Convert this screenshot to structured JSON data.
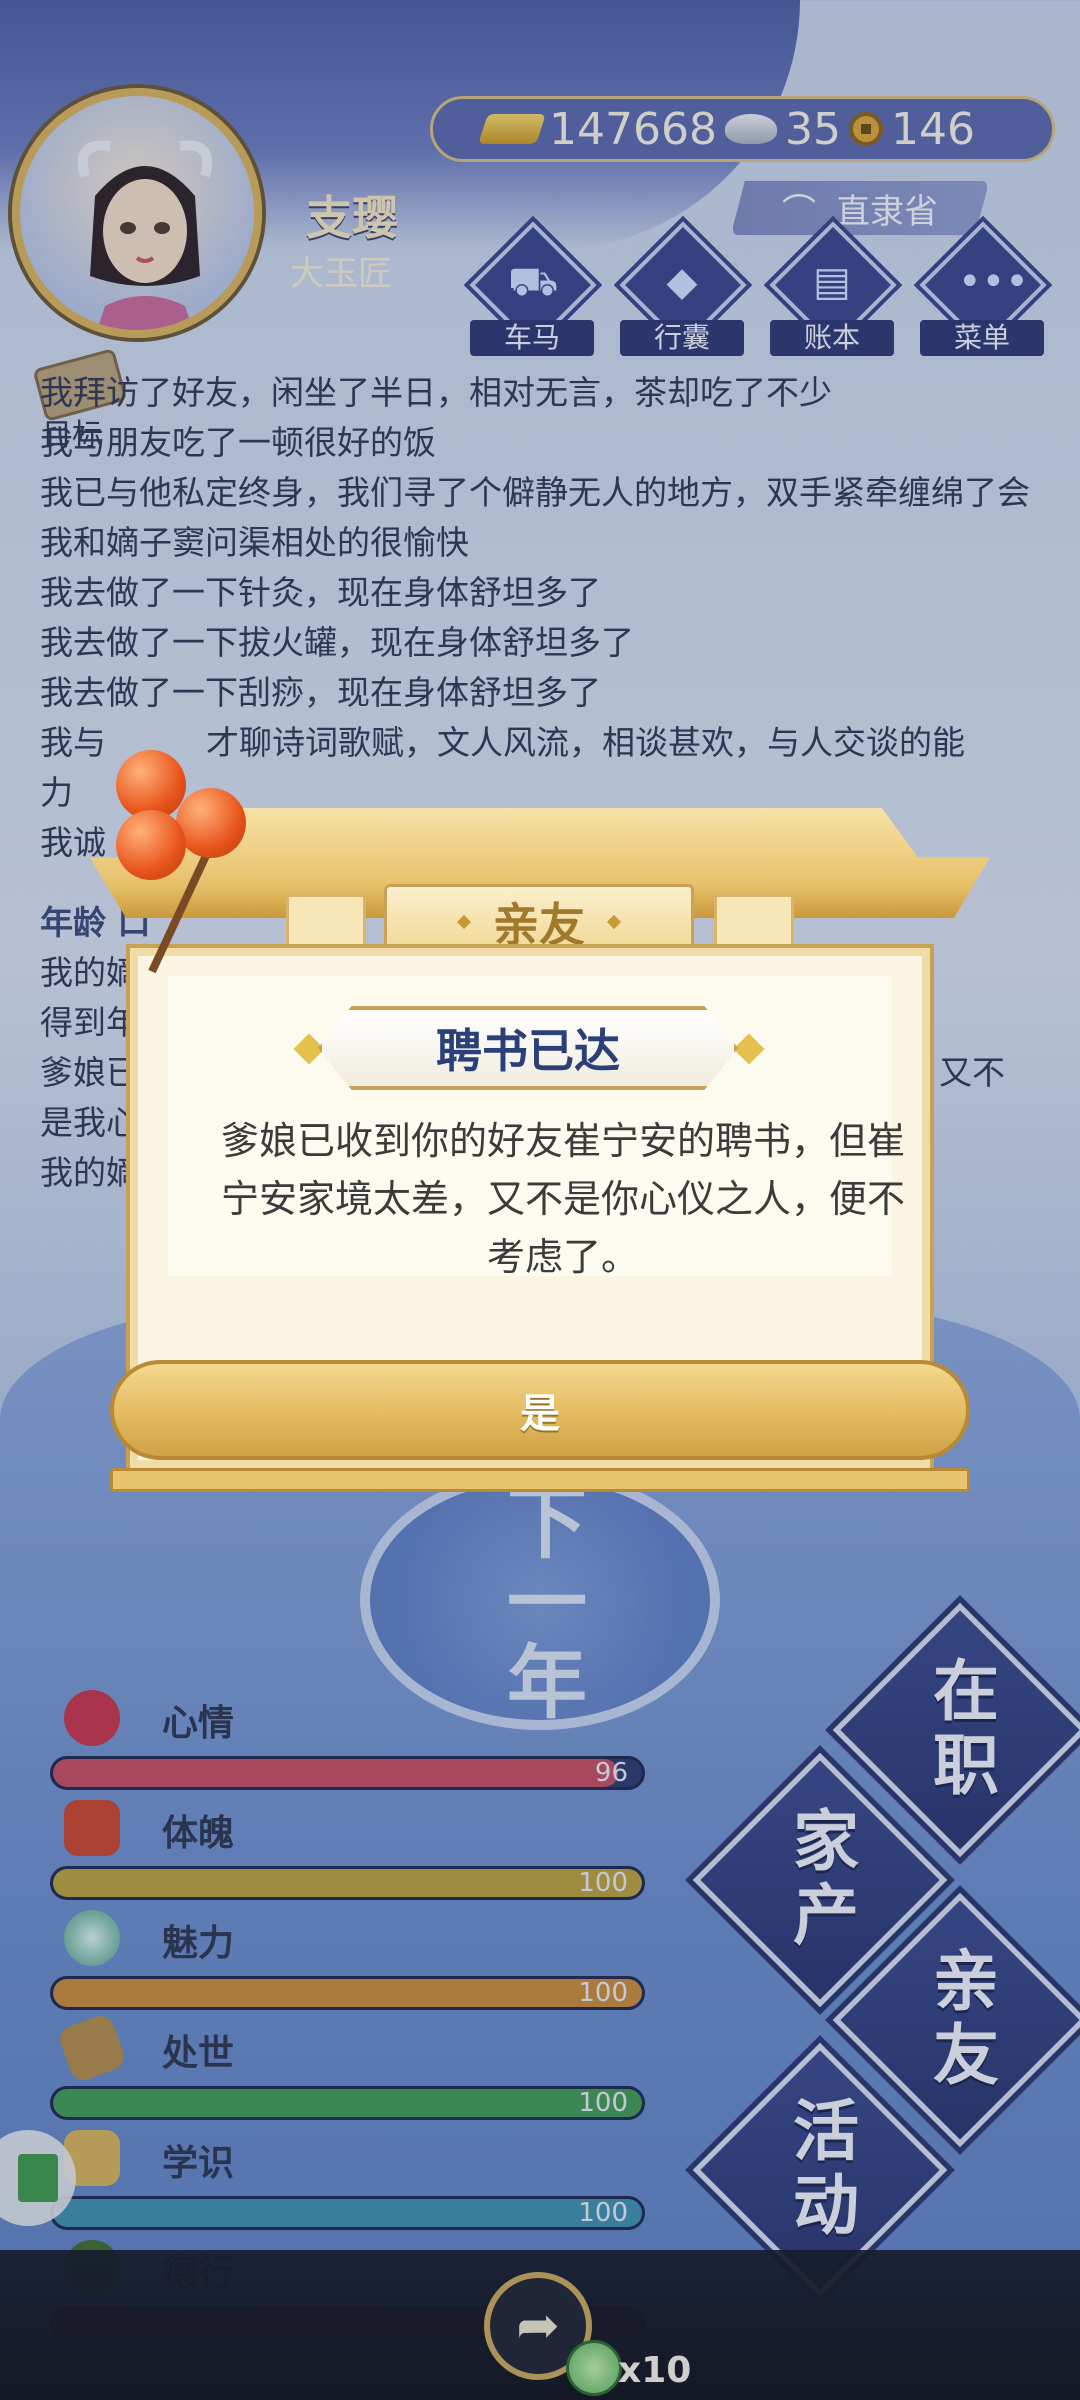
{
  "header": {
    "name": "支璎",
    "title": "大玉匠",
    "currency": {
      "gold": "147668",
      "silver": "35",
      "coins": "146"
    },
    "region": "直隶省",
    "menu": [
      {
        "label": "车马",
        "icon": "carriage-icon"
      },
      {
        "label": "行囊",
        "icon": "bag-icon"
      },
      {
        "label": "账本",
        "icon": "ledger-icon"
      },
      {
        "label": "菜单",
        "icon": "menu-dots-icon"
      }
    ]
  },
  "goal_label": "目标",
  "log": [
    "我拜访了好友，闲坐了半日，相对无言，茶却吃了不少",
    "我与朋友吃了一顿很好的饭",
    "我已与他私定终身，我们寻了个僻静无人的地方，双手紧牵缠绵了会",
    "我和嫡子窦问渠相处的很愉快",
    "我去做了一下针灸，现在身体舒坦多了",
    "我去做了一下拔火罐，现在身体舒坦多了",
    "我去做了一下刮痧，现在身体舒坦多了",
    "我与",
    "力",
    "我诚"
  ],
  "log_fragments": {
    "line8_tail": "才聊诗词歌赋，文人风流，相谈甚欢，与人交谈的能",
    "age_prefix": "年龄",
    "age_char": "口",
    "lines": [
      "我的嫡",
      "得到年",
      "爹娘已",
      "是我心",
      "我的嫡"
    ],
    "trail": "又不"
  },
  "next_year": "下一年",
  "stats": [
    {
      "label": "心情",
      "value": "96",
      "pct": 96,
      "color": "#c54d63"
    },
    {
      "label": "体魄",
      "value": "100",
      "pct": 100,
      "color": "#b9a23f"
    },
    {
      "label": "魅力",
      "value": "100",
      "pct": 100,
      "color": "#c98a3a"
    },
    {
      "label": "处世",
      "value": "100",
      "pct": 100,
      "color": "#3f9a55"
    },
    {
      "label": "学识",
      "value": "100",
      "pct": 100,
      "color": "#3f8fb0"
    },
    {
      "label": "德行",
      "value": "",
      "pct": 100,
      "color": "#6b2a55"
    }
  ],
  "actions": [
    "在职",
    "家产",
    "亲友",
    "活动"
  ],
  "reward_count": "x10",
  "dialog": {
    "tab": "亲友",
    "headline": "聘书已达",
    "message": "爹娘已收到你的好友崔宁安的聘书，但崔宁安家境太差，又不是你心仪之人，便不考虑了。",
    "confirm": "是"
  }
}
